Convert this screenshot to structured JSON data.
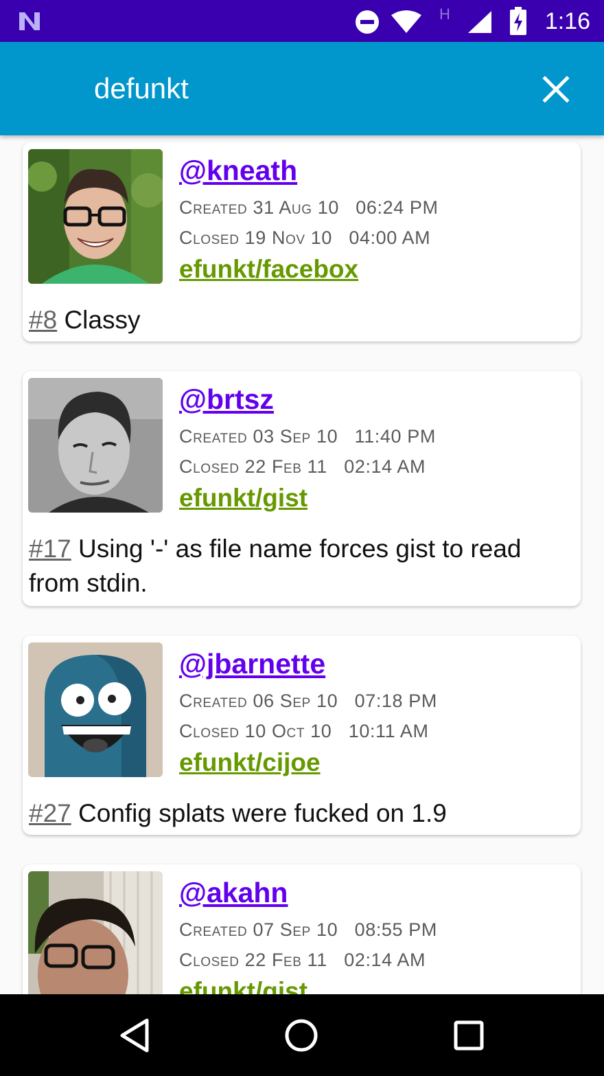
{
  "status_bar": {
    "time": "1:16",
    "icons": [
      "notification-n-icon",
      "do-not-disturb-icon",
      "wifi-icon",
      "h-network-icon",
      "cell-signal-icon",
      "battery-charging-icon"
    ],
    "network_label": "H",
    "background": "#3a00b0"
  },
  "app_bar": {
    "title": "defunkt",
    "close_icon": "close-icon",
    "background": "#0297cc"
  },
  "items": [
    {
      "user": "@kneath",
      "created": "Created 31 Aug 10   06:24 PM",
      "closed": "Closed 19 Nov 10   04:00 AM",
      "repo": "efunkt/facebox",
      "number": "#8",
      "title": "Classy"
    },
    {
      "user": "@brtsz",
      "created": "Created 03 Sep 10   11:40 PM",
      "closed": "Closed 22 Feb 11   02:14 AM",
      "repo": "efunkt/gist",
      "number": "#17",
      "title": "Using '-' as file name forces gist to read from stdin."
    },
    {
      "user": "@jbarnette",
      "created": "Created 06 Sep 10   07:18 PM",
      "closed": "Closed 10 Oct 10   10:11 AM",
      "repo": "efunkt/cijoe",
      "number": "#27",
      "title": "Config splats were fucked on 1.9"
    },
    {
      "user": "@akahn",
      "created": "Created 07 Sep 10   08:55 PM",
      "closed": "Closed 22 Feb 11   02:14 AM",
      "repo": "efunkt/gist",
      "number": "",
      "title": ""
    }
  ],
  "colors": {
    "user_link": "#6200ee",
    "repo_link": "#669900",
    "date_text": "#5a5a5a"
  },
  "nav_bar": {
    "buttons": [
      "back-icon",
      "home-icon",
      "recents-icon"
    ]
  }
}
